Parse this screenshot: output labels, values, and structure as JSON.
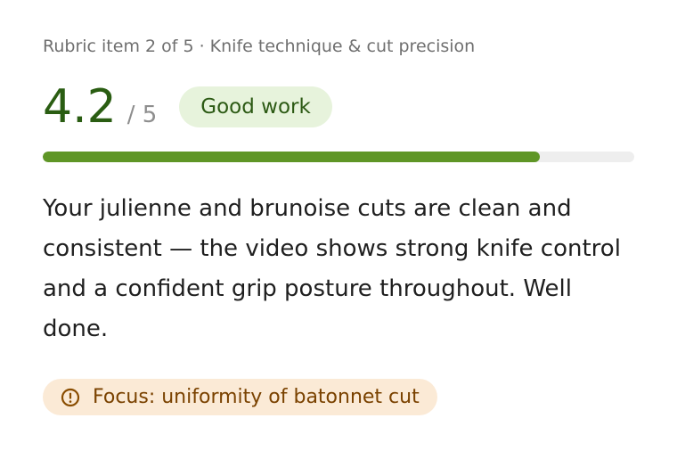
{
  "rubric": {
    "eyebrow": "Rubric item 2 of 5 · Knife technique & cut precision",
    "score": "4.2",
    "score_max": "/ 5",
    "score_fraction": 0.84,
    "badge_label": "Good work",
    "feedback": "Your julienne and brunoise cuts are clean and consistent — the video shows strong knife control and a confident grip posture throughout. Well done.",
    "focus_label": "Focus: uniformity of batonnet cut",
    "focus_icon": "warning-circle-icon"
  },
  "colors": {
    "score": "#2a5d12",
    "badge_bg": "#e7f3dc",
    "progress_fill": "#5f9626",
    "progress_track": "#eeeeee",
    "focus_bg": "#fbead6",
    "focus_text": "#7a4200"
  }
}
